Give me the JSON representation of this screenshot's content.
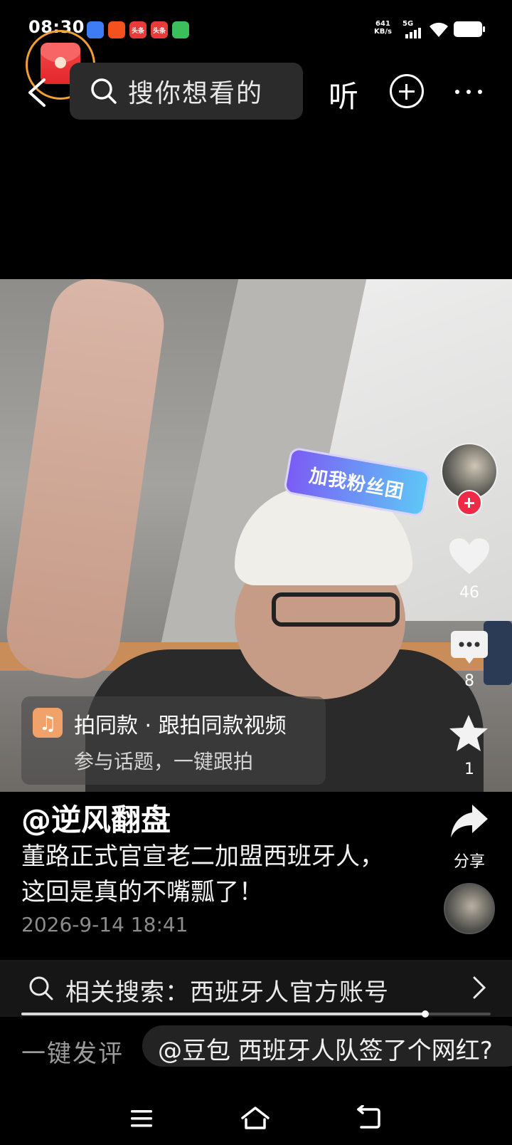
{
  "status_bar": {
    "time": "08:30",
    "net_speed_value": "641",
    "net_speed_unit": "KB/s",
    "network": "5G",
    "app_icons": [
      {
        "name": "blue-app-icon",
        "label": "",
        "color": "#3d7cf5"
      },
      {
        "name": "kuaishou-app-icon",
        "label": "",
        "color": "#f4511e"
      },
      {
        "name": "toutiao-app-icon",
        "label": "头条",
        "color": "#e83a3a"
      },
      {
        "name": "toutiao-app-icon-2",
        "label": "头条",
        "color": "#e83a3a"
      },
      {
        "name": "green-app-icon",
        "label": "",
        "color": "#3bbf5b"
      }
    ]
  },
  "topbar": {
    "search_placeholder": "搜你想看的",
    "listen_label": "听"
  },
  "video": {
    "sticker_text": "加我粉丝团"
  },
  "actions": {
    "like_count": "46",
    "comment_count": "8",
    "favorite_count": "1",
    "share_label": "分享"
  },
  "challenge": {
    "title": "拍同款 · 跟拍同款视频",
    "subtitle": "参与话题，一键跟拍"
  },
  "post": {
    "author": "@逆风翻盘",
    "description": "董路正式官宣老二加盟西班牙人，这回是真的不嘴瓢了！",
    "date": "2026-9-14 18:41"
  },
  "related_search": {
    "text": "相关搜索：西班牙人官方账号"
  },
  "playback": {
    "progress": 0.86
  },
  "comment_bar": {
    "quick_comment_label": "一键发评",
    "ai_suggestion": "@豆包 西班牙人队签了个网红?"
  },
  "colors": {
    "accent_red": "#ee2a45",
    "ring_orange": "#f0a030"
  }
}
